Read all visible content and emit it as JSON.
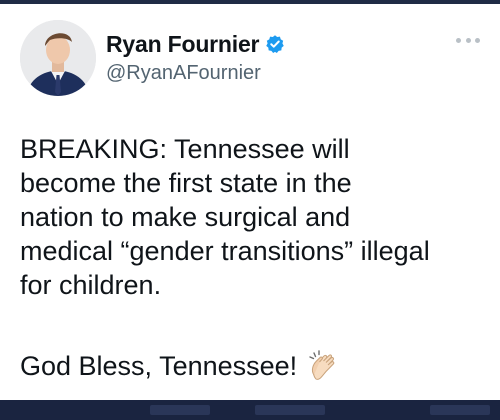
{
  "tweet": {
    "author": {
      "display_name": "Ryan Fournier",
      "handle": "@RyanAFournier",
      "verified": true
    },
    "body_lines": [
      "BREAKING: Tennessee will",
      "become the first state in the",
      "nation to make surgical and",
      "medical “gender transitions” illegal",
      "for children."
    ],
    "closing_text": "God Bless, Tennessee!",
    "closing_emoji": "clapping-hands-icon"
  },
  "icons": {
    "verified": "verified-badge-icon",
    "more": "more-options-icon"
  },
  "colors": {
    "verified_blue": "#1d9bf0",
    "text_primary": "#0f1419",
    "text_secondary": "#536471",
    "frame_navy": "#1a2440"
  }
}
